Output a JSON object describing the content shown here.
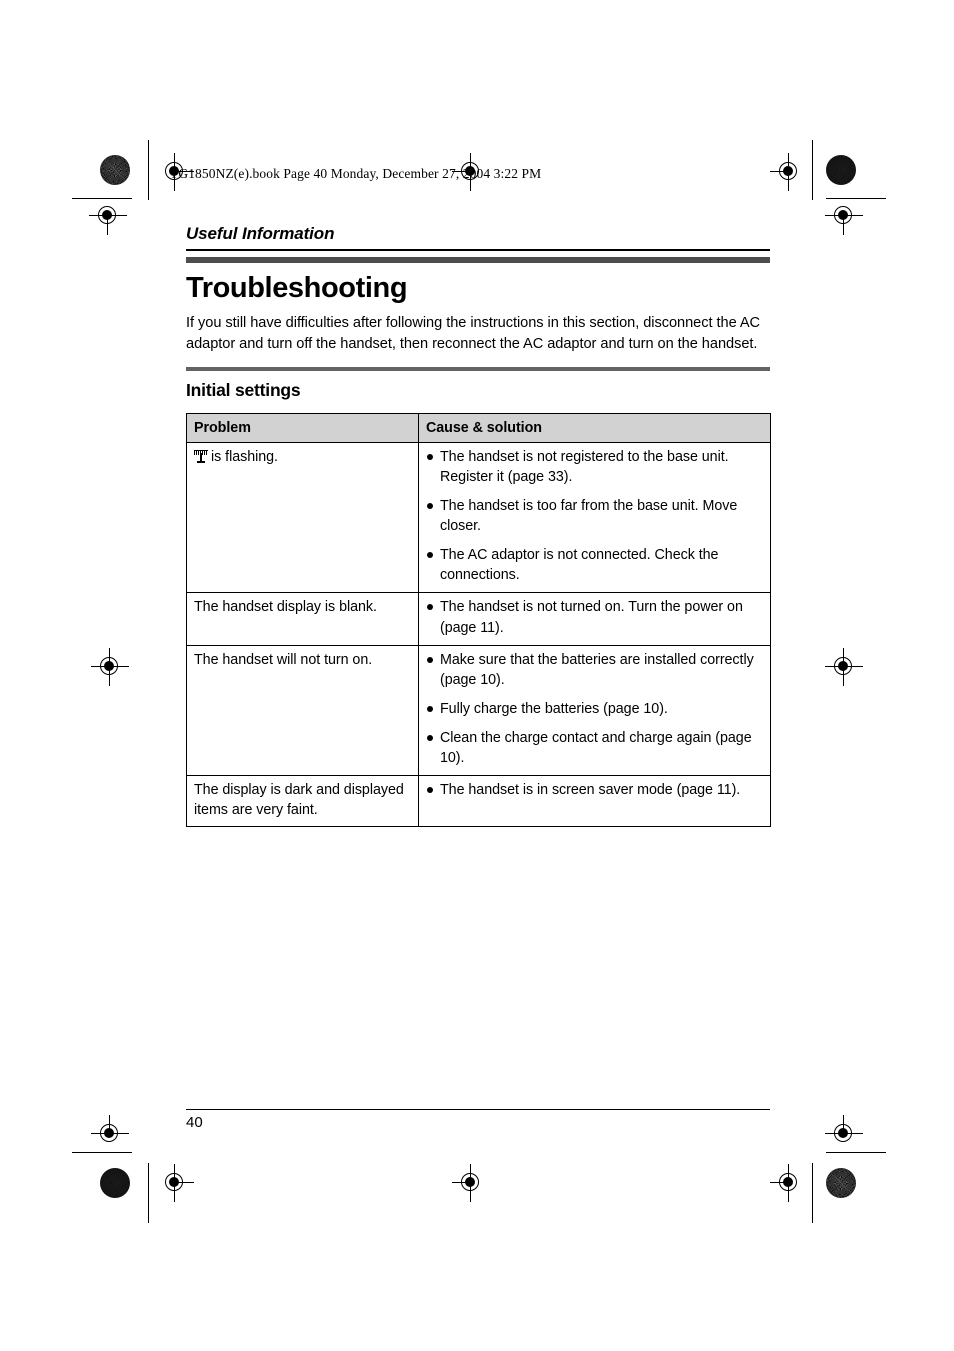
{
  "print_marks": {
    "file_header": "TG1850NZ(e).book  Page 40  Monday, December 27, 2004  3:22 PM",
    "registration_icon": "registration-target",
    "halftone_icon": "halftone-density-patch"
  },
  "header": {
    "kicker": "Useful Information"
  },
  "main": {
    "title": "Troubleshooting",
    "intro": "If you still have difficulties after following the instructions in this section, disconnect the AC adaptor and turn off the handset, then reconnect the AC adaptor and turn on the handset.",
    "subtitle": "Initial settings"
  },
  "table": {
    "columns": [
      "Problem",
      "Cause & solution"
    ],
    "rows": [
      {
        "problem_icon": "antenna-icon",
        "problem": "is flashing.",
        "causes": [
          "The handset is not registered to the base unit. Register it (page 33).",
          "The handset is too far from the base unit. Move closer.",
          "The AC adaptor is not connected. Check the connections."
        ]
      },
      {
        "problem_icon": "",
        "problem": "The handset display is blank.",
        "causes": [
          "The handset is not turned on. Turn the power on (page 11)."
        ]
      },
      {
        "problem_icon": "",
        "problem": "The handset will not turn on.",
        "causes": [
          "Make sure that the batteries are installed correctly (page 10).",
          "Fully charge the batteries (page 10).",
          "Clean the charge contact and charge again (page 10)."
        ]
      },
      {
        "problem_icon": "",
        "problem": "The display is dark and displayed items are very faint.",
        "causes": [
          "The handset is in screen saver mode (page 11)."
        ]
      }
    ]
  },
  "footer": {
    "page_number": "40"
  },
  "colors": {
    "heading_bar": "#4d4d4d",
    "sub_bar": "#636363",
    "table_header_bg": "#d2d2d2",
    "rule": "#000000"
  }
}
